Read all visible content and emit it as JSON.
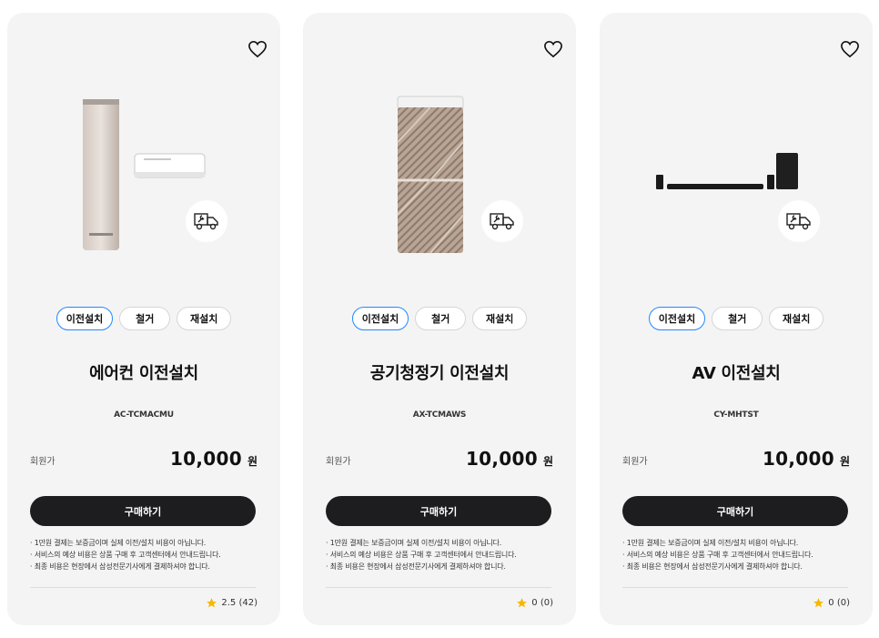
{
  "cards": [
    {
      "chips": [
        "이전설치",
        "철거",
        "재설치"
      ],
      "title": "에어컨 이전설치",
      "model": "AC-TCMACMU",
      "price_label": "회원가",
      "price": "10,000",
      "unit": "원",
      "buy_label": "구매하기",
      "notes": [
        "1만원 결제는 보증금이며 실제 이전/설치 비용이 아닙니다.",
        "서비스의 예상 비용은 상품 구매 후 고객센터에서 안내드립니다.",
        "최종 비용은 현장에서 삼성전문기사에게 결제하셔야 합니다."
      ],
      "rating": "2.5 (42)"
    },
    {
      "chips": [
        "이전설치",
        "철거",
        "재설치"
      ],
      "title": "공기청정기 이전설치",
      "model": "AX-TCMAWS",
      "price_label": "회원가",
      "price": "10,000",
      "unit": "원",
      "buy_label": "구매하기",
      "notes": [
        "1만원 결제는 보증금이며 실제 이전/설치 비용이 아닙니다.",
        "서비스의 예상 비용은 상품 구매 후 고객센터에서 안내드립니다.",
        "최종 비용은 현장에서 삼성전문기사에게 결제하셔야 합니다."
      ],
      "rating": "0 (0)"
    },
    {
      "chips": [
        "이전설치",
        "철거",
        "재설치"
      ],
      "title": "AV 이전설치",
      "model": "CY-MHTST",
      "price_label": "회원가",
      "price": "10,000",
      "unit": "원",
      "buy_label": "구매하기",
      "notes": [
        "1만원 결제는 보증금이며 실제 이전/설치 비용이 아닙니다.",
        "서비스의 예상 비용은 상품 구매 후 고객센터에서 안내드립니다.",
        "최종 비용은 현장에서 삼성전문기사에게 결제하셔야 합니다."
      ],
      "rating": "0 (0)"
    }
  ],
  "icons": {
    "wishlist": "heart-outline-icon",
    "service": "truck-wrench-icon",
    "rating": "star-icon"
  },
  "colors": {
    "accent": "#2189ff",
    "button": "#1d1d1f",
    "star": "#f5b800",
    "card_bg": "#f4f4f4"
  }
}
